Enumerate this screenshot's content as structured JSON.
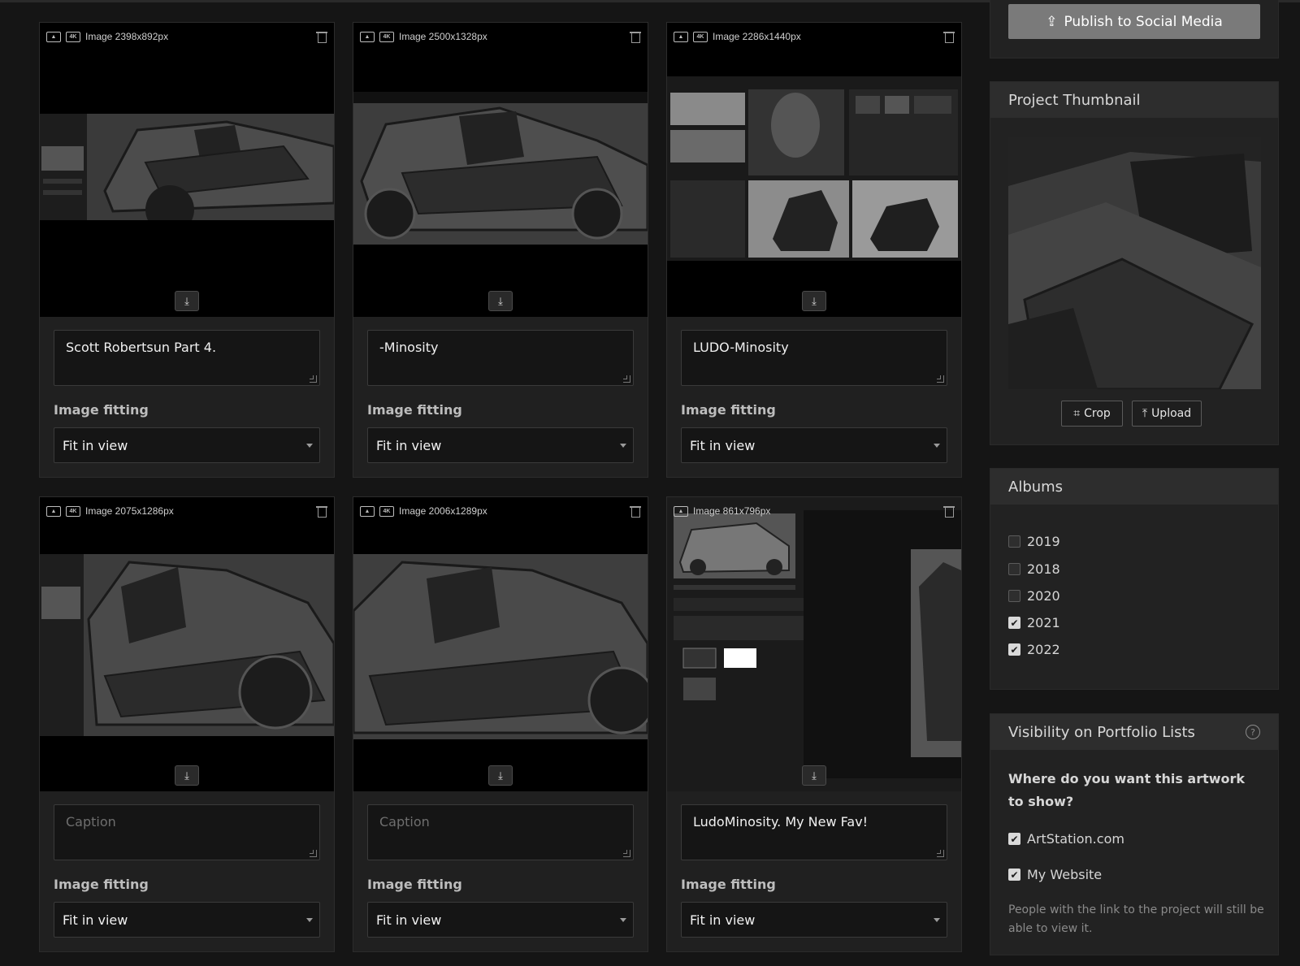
{
  "cards": [
    {
      "meta": "Image 2398x892px",
      "caption": "Scott Robertsun Part 4.",
      "placeholder": "Caption",
      "fit_label": "Image fitting",
      "fit_value": "Fit in view"
    },
    {
      "meta": "Image 2500x1328px",
      "caption": "-Minosity",
      "placeholder": "Caption",
      "fit_label": "Image fitting",
      "fit_value": "Fit in view"
    },
    {
      "meta": "Image 2286x1440px",
      "caption": "LUDO-Minosity",
      "placeholder": "Caption",
      "fit_label": "Image fitting",
      "fit_value": "Fit in view"
    },
    {
      "meta": "Image 2075x1286px",
      "caption": "",
      "placeholder": "Caption",
      "fit_label": "Image fitting",
      "fit_value": "Fit in view"
    },
    {
      "meta": "Image 2006x1289px",
      "caption": "",
      "placeholder": "Caption",
      "fit_label": "Image fitting",
      "fit_value": "Fit in view"
    },
    {
      "meta": "Image 861x796px",
      "caption": "LudoMinosity. My New Fav!",
      "placeholder": "Caption",
      "fit_label": "Image fitting",
      "fit_value": "Fit in view"
    }
  ],
  "media_icons": {
    "image": "image-icon",
    "badge": "4K",
    "delete": "trash-icon",
    "download": "download-icon"
  },
  "sidebar": {
    "publish_label": "Publish to Social Media",
    "thumbnail": {
      "title": "Project Thumbnail",
      "crop_label": "Crop",
      "upload_label": "Upload"
    },
    "albums": {
      "title": "Albums",
      "items": [
        {
          "label": "2019",
          "checked": false
        },
        {
          "label": "2018",
          "checked": false
        },
        {
          "label": "2020",
          "checked": false
        },
        {
          "label": "2021",
          "checked": true
        },
        {
          "label": "2022",
          "checked": true
        }
      ]
    },
    "visibility": {
      "title": "Visibility on Portfolio Lists",
      "question": "Where do you want this artwork to show?",
      "options": [
        {
          "label": "ArtStation.com",
          "checked": true
        },
        {
          "label": "My Website",
          "checked": true
        }
      ],
      "note": "People with the link to the project will still be able to view it."
    }
  },
  "colors": {
    "background": "#151515",
    "panel": "#222222",
    "panel_header": "#2d2d2d",
    "publish_button": "#7a7a7a"
  }
}
